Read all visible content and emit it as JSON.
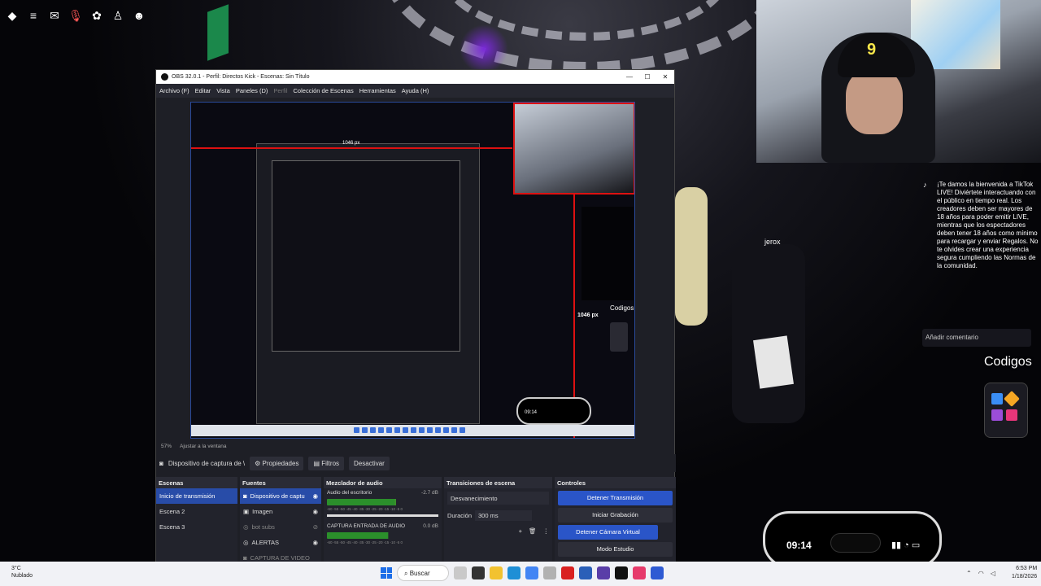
{
  "stream": {
    "viewer_name": "jerox",
    "codigos_label": "Codigos",
    "tiktok_welcome": "¡Te damos la bienvenida a TikTok LIVE! Diviértete interactuando con el público en tiempo real. Los creadores deben ser mayores de 18 años para poder emitir LIVE, mientras que los espectadores deben tener 18 años como mínimo para recargar y enviar Regalos. No te olvides crear una experiencia segura cumpliendo las Normas de la comunidad.",
    "comment_placeholder": "Añadir comentario",
    "phone_time": "09:14",
    "cap_number": "9"
  },
  "obs": {
    "title": "OBS 32.0.1 - Perfil: Directos Kick - Escenas: Sin Título",
    "window_controls": [
      "—",
      "☐",
      "✕"
    ],
    "menu": [
      "Archivo (F)",
      "Editar",
      "Vista",
      "Paneles (D)",
      "Perfil",
      "Colección de Escenas",
      "Herramientas",
      "Ayuda (H)"
    ],
    "preview": {
      "px_label": "1046 px",
      "px_label_top": "1046 px",
      "codigos": "Codigos",
      "phone_time": "09:14"
    },
    "zoom": "57%",
    "fit_label": "Ajustar a la ventana",
    "source_bar": {
      "source": "Dispositivo de captura de \\",
      "properties": "Propiedades",
      "filters": "Filtros",
      "deactivate": "Desactivar"
    },
    "scenes": {
      "title": "Escenas",
      "items": [
        "Inicio de transmisión",
        "Escena 2",
        "Escena 3"
      ]
    },
    "sources": {
      "title": "Fuentes",
      "items": [
        "Dispositivo de captu",
        "Imagen",
        "bot subs",
        "ALERTAS",
        "CAPTURA DE VIDEO"
      ]
    },
    "mixer": {
      "title": "Mezclador de audio",
      "channels": [
        {
          "name": "Audio del escritorio",
          "db": "-2.7 dB",
          "level": 0.62
        },
        {
          "name": "CAPTURA ENTRADA DE AUDIO",
          "db": "0.0 dB",
          "level": 0.55
        }
      ],
      "scale": "-60 -55 -50 -45 -40 -35 -30 -25 -20 -15 -10 -5 0"
    },
    "transitions": {
      "title": "Transiciones de escena",
      "type": "Desvanecimiento",
      "duration_label": "Duración",
      "duration_value": "300 ms"
    },
    "controls": {
      "title": "Controles",
      "buttons": [
        "Detener Transmisión",
        "Iniciar Grabación",
        "Detener Cámara Virtual",
        "Modo Estudio"
      ]
    }
  },
  "taskbar": {
    "temp": "3°C",
    "weather": "Nublado",
    "search": "Buscar",
    "time": "6:53 PM",
    "date": "1/18/2026"
  },
  "colors": {
    "accent_blue": "#2a55c8",
    "selection_blue": "#284ca8",
    "guide_red": "#dd1111",
    "hat_logo_yellow": "#f7e64a"
  }
}
